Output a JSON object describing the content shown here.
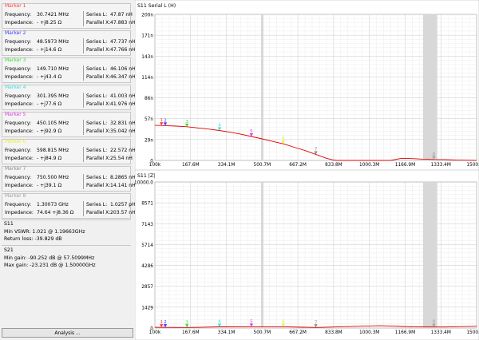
{
  "markers": [
    {
      "title": "Marker 1",
      "color": "#ff3b3b",
      "frequency_label": "Frequency:",
      "frequency": "30.7421  MHz",
      "impedance_label": "Impedance:",
      "impedance": "-  +j8.25  Ω",
      "series_label": "Series L:",
      "series": "47.87  nH",
      "parallel_label": "Parallel X:",
      "parallel": "47.883  nH"
    },
    {
      "title": "Marker 2",
      "color": "#3a3aff",
      "frequency_label": "Frequency:",
      "frequency": "48.5973  MHz",
      "impedance_label": "Impedance:",
      "impedance": "-  +j14.6  Ω",
      "series_label": "Series L:",
      "series": "47.737  nH",
      "parallel_label": "Parallel X:",
      "parallel": "47.766  nH"
    },
    {
      "title": "Marker 3",
      "color": "#33dd33",
      "frequency_label": "Frequency:",
      "frequency": "149.710  MHz",
      "impedance_label": "Impedance:",
      "impedance": "-  +j43.4  Ω",
      "series_label": "Series L:",
      "series": "46.106  nH",
      "parallel_label": "Parallel X:",
      "parallel": "46.347  nH"
    },
    {
      "title": "Marker 4",
      "color": "#33e0e0",
      "frequency_label": "Frequency:",
      "frequency": "301.395  MHz",
      "impedance_label": "Impedance:",
      "impedance": "-  +j77.6  Ω",
      "series_label": "Series L:",
      "series": "41.003  nH",
      "parallel_label": "Parallel X:",
      "parallel": "41.976  nH"
    },
    {
      "title": "Marker 5",
      "color": "#e23ae2",
      "frequency_label": "Frequency:",
      "frequency": "450.105  MHz",
      "impedance_label": "Impedance:",
      "impedance": "-  +j92.9  Ω",
      "series_label": "Series L:",
      "series": "32.831  nH",
      "parallel_label": "Parallel X:",
      "parallel": "35.042  nH"
    },
    {
      "title": "Marker 6",
      "color": "#eded30",
      "frequency_label": "Frequency:",
      "frequency": "598.815  MHz",
      "impedance_label": "Impedance:",
      "impedance": "-  +j84.9  Ω",
      "series_label": "Series L:",
      "series": "22.572  nH",
      "parallel_label": "Parallel X:",
      "parallel": "25.54  nH"
    },
    {
      "title": "Marker 7",
      "color": "#8a8a8a",
      "frequency_label": "Frequency:",
      "frequency": "750.500  MHz",
      "impedance_label": "Impedance:",
      "impedance": "-  +j39.1  Ω",
      "series_label": "Series L:",
      "series": "8.2865  nH",
      "parallel_label": "Parallel X:",
      "parallel": "14.141  nH"
    },
    {
      "title": "Marker 8",
      "color": "#a0a0a0",
      "frequency_label": "Frequency:",
      "frequency": "1.30073  GHz",
      "impedance_label": "Impedance:",
      "impedance": "74.64  +j8.36  Ω",
      "series_label": "Series L:",
      "series": "1.0257  pH",
      "parallel_label": "Parallel X:",
      "parallel": "203.57  nH"
    }
  ],
  "s11_section": {
    "title": "S11",
    "min_vswr": "Min VSWR:   1.021  @ 1.19663GHz",
    "return_loss": "Return loss:   -39.829  dB"
  },
  "s21_section": {
    "title": "S21",
    "min_gain": "Min gain:   -90.252  dB @ 57.5099MHz",
    "max_gain": "Max gain:   -23.231  dB @ 1.50000GHz"
  },
  "analysis_button": "Analysis ...",
  "chart_data": [
    {
      "type": "line",
      "title": "S11 Serial L (H)",
      "y_tick_labels": [
        "200n",
        "171n",
        "143n",
        "114n",
        "86n",
        "57n",
        "29n",
        "0"
      ],
      "x_tick_labels": [
        "100k",
        "167.6M",
        "334.1M",
        "500.7M",
        "667.2M",
        "833.8M",
        "1000.3M",
        "1166.9M",
        "1333.4M",
        "1500.0M"
      ],
      "ylim": [
        0,
        200
      ],
      "y_unit": "nH",
      "xlim": [
        0.1,
        1500
      ],
      "x_unit": "MHz",
      "grid": true,
      "series": [
        {
          "color": "#e00000",
          "x": [
            0.1,
            30,
            48,
            100,
            150,
            200,
            250,
            300,
            350,
            400,
            450,
            500,
            550,
            600,
            650,
            700,
            750,
            800,
            833,
            850,
            1000,
            1100,
            1150,
            1200,
            1250,
            1300,
            1350,
            1400,
            1450,
            1500
          ],
          "y": [
            48,
            47.9,
            47.7,
            47,
            46.1,
            44.5,
            43,
            41,
            38.7,
            36,
            32.8,
            29.5,
            26,
            22.6,
            18,
            13.5,
            8.3,
            3,
            0.5,
            0,
            0,
            0,
            3,
            2.5,
            1.8,
            1.3,
            1.2,
            0.5,
            0.3,
            0
          ]
        }
      ],
      "marker_x": [
        30.7,
        48.6,
        149.7,
        301.4,
        450.1,
        598.8,
        750.5,
        1300.7
      ],
      "marker_labels": [
        "1",
        "2",
        "3",
        "4",
        "5",
        "6",
        "7",
        "8"
      ]
    },
    {
      "type": "line",
      "title": "S11 |Z|",
      "y_tick_labels": [
        "10000.0",
        "8571",
        "7143",
        "5714",
        "4286",
        "2857",
        "1429",
        "0"
      ],
      "x_tick_labels": [
        "100k",
        "167.6M",
        "334.1M",
        "500.7M",
        "667.2M",
        "833.8M",
        "1000.3M",
        "1166.9M",
        "1333.4M",
        "1500.0M"
      ],
      "ylim": [
        0,
        10000
      ],
      "y_unit": "Ω",
      "xlim": [
        0.1,
        1500
      ],
      "x_unit": "MHz",
      "grid": true,
      "series": [
        {
          "color": "#e00000",
          "x": [
            0.1,
            150,
            300,
            450,
            600,
            750,
            900,
            1050,
            1200,
            1350,
            1500
          ],
          "y": [
            50,
            40,
            80,
            90,
            85,
            40,
            100,
            160,
            80,
            70,
            120
          ]
        }
      ],
      "marker_x": [
        30.7,
        48.6,
        149.7,
        301.4,
        450.1,
        598.8,
        750.5,
        1300.7
      ],
      "marker_labels": [
        "1",
        "2",
        "3",
        "4",
        "5",
        "6",
        "7",
        "8"
      ]
    }
  ]
}
